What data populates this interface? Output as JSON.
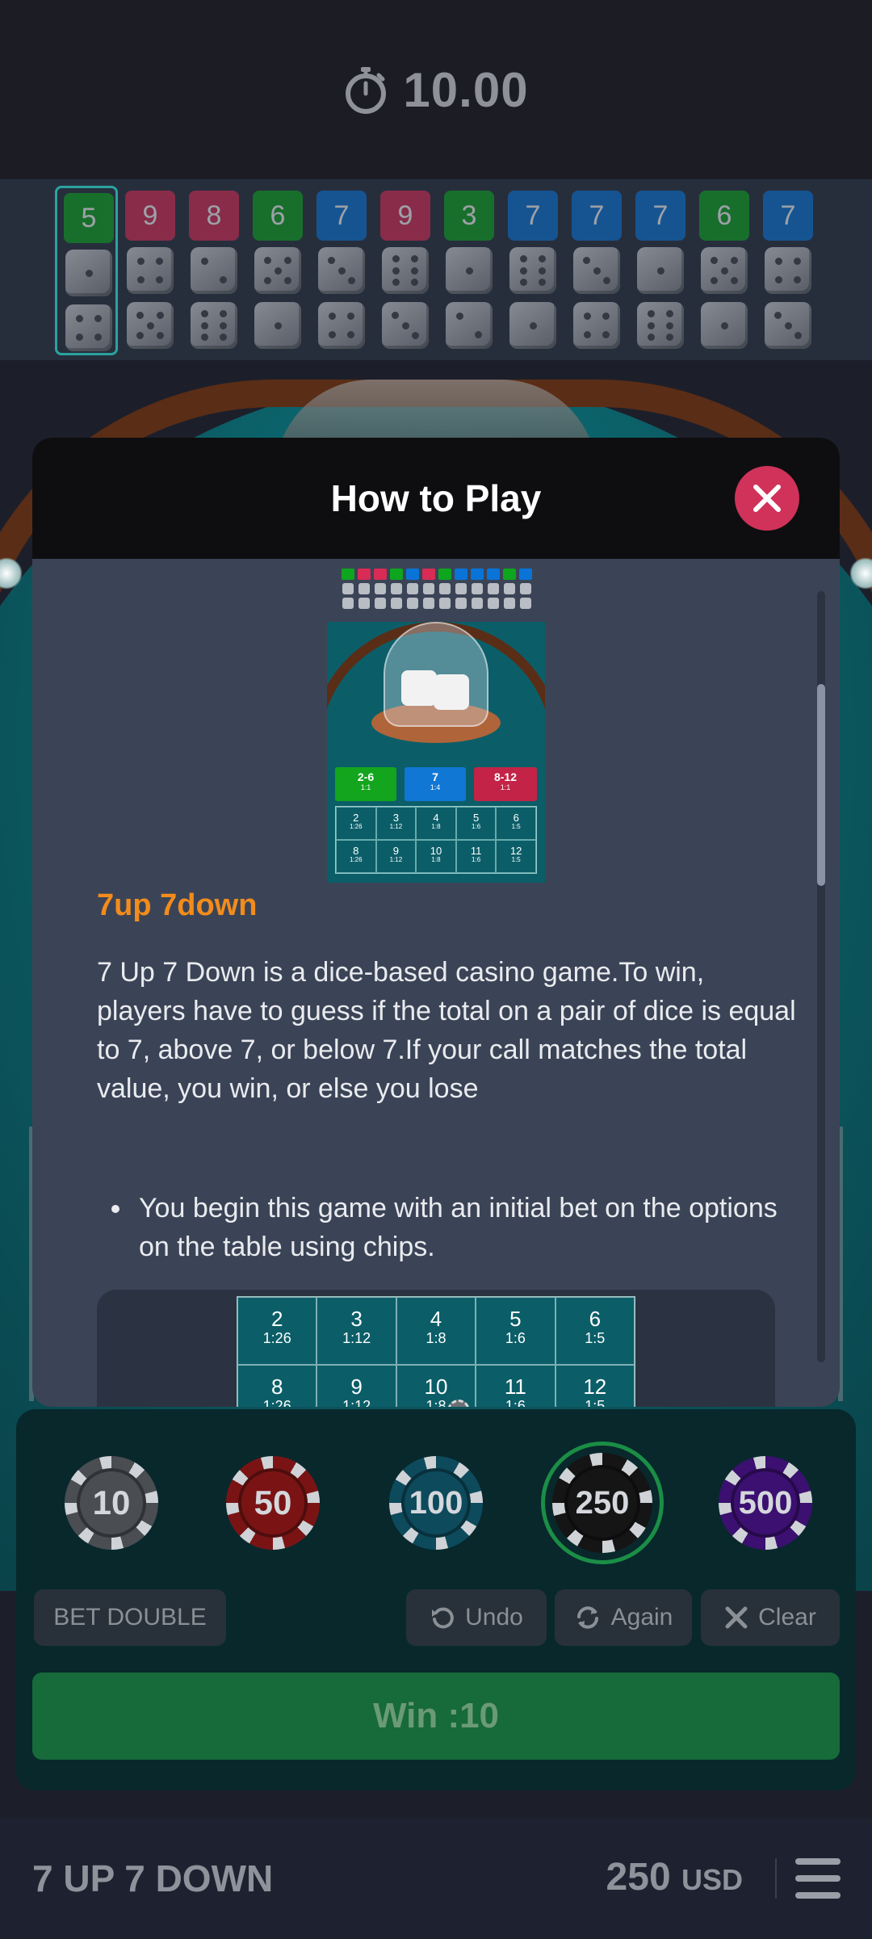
{
  "timer": {
    "icon": "stopwatch-icon",
    "value": "10.00"
  },
  "history": [
    {
      "number": "5",
      "color": "green",
      "active": true
    },
    {
      "number": "9",
      "color": "red"
    },
    {
      "number": "8",
      "color": "red"
    },
    {
      "number": "6",
      "color": "green"
    },
    {
      "number": "7",
      "color": "blue"
    },
    {
      "number": "9",
      "color": "red"
    },
    {
      "number": "3",
      "color": "green"
    },
    {
      "number": "7",
      "color": "blue"
    },
    {
      "number": "7",
      "color": "blue"
    },
    {
      "number": "7",
      "color": "blue"
    },
    {
      "number": "6",
      "color": "green"
    },
    {
      "number": "7",
      "color": "blue"
    }
  ],
  "modal": {
    "title": "How to Play",
    "close_icon": "close-icon",
    "section_title": "7up 7down",
    "description": "7 Up 7 Down is a dice-based casino game.To win, players have to guess if the total on a pair of dice is equal to 7, above 7, or below 7.If your call matches the total value, you win, or else you lose",
    "bullet_1": "You begin this game with an initial bet on the options on the table using chips.",
    "preview_bets": [
      {
        "label": "2-6",
        "odds": "1:1"
      },
      {
        "label": "7",
        "odds": "1:4"
      },
      {
        "label": "8-12",
        "odds": "1:1"
      }
    ],
    "example_grid": [
      {
        "n": "2",
        "odds": "1:26"
      },
      {
        "n": "3",
        "odds": "1:12"
      },
      {
        "n": "4",
        "odds": "1:8"
      },
      {
        "n": "5",
        "odds": "1:6"
      },
      {
        "n": "6",
        "odds": "1:5"
      },
      {
        "n": "8",
        "odds": "1:26"
      },
      {
        "n": "9",
        "odds": "1:12"
      },
      {
        "n": "10",
        "odds": "1:8"
      },
      {
        "n": "11",
        "odds": "1:6"
      },
      {
        "n": "12",
        "odds": "1:5"
      }
    ],
    "example_chip": "10"
  },
  "chips": [
    {
      "value": "10",
      "color": "#4a4d52",
      "selected": false
    },
    {
      "value": "50",
      "color": "#7a1414",
      "selected": false
    },
    {
      "value": "100",
      "color": "#0d4a5c",
      "selected": false
    },
    {
      "value": "250",
      "color": "#151515",
      "selected": true
    },
    {
      "value": "500",
      "color": "#3b1070",
      "selected": false
    }
  ],
  "actions": {
    "bet_double": "BET DOUBLE",
    "undo": "Undo",
    "again": "Again",
    "clear": "Clear"
  },
  "win_button": "Win :10",
  "footer": {
    "game_name": "7 UP 7 DOWN",
    "balance": "250",
    "currency": "USD",
    "menu_icon": "hamburger-menu-icon"
  }
}
